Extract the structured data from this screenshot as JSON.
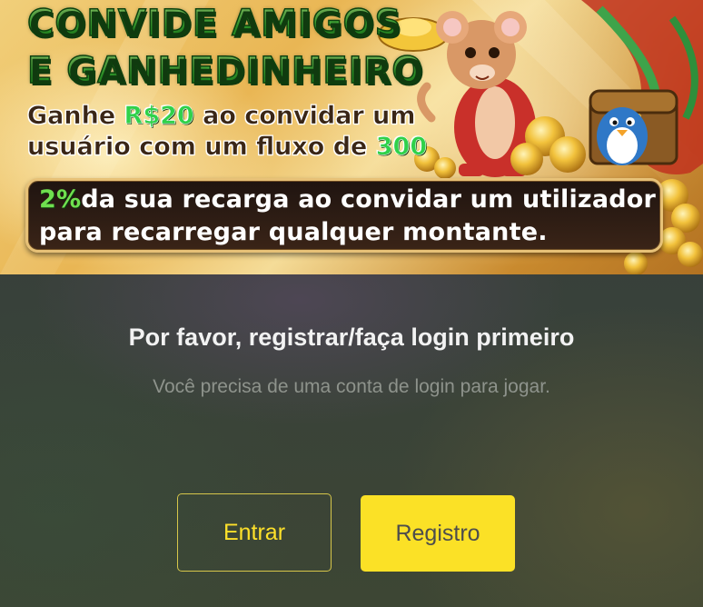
{
  "banner": {
    "headline_line1": "CONVIDE AMIGOS",
    "headline_line2": "E GANHEDINHEIRO",
    "reward_line1_prefix": "Ganhe ",
    "reward_amount": "R$20",
    "reward_line1_suffix": " ao convidar um",
    "reward_line2_prefix": "usuário com um fluxo de ",
    "reward_flow": "300",
    "promo_percent": "2%",
    "promo_line1_rest": "da sua recarga ao convidar um utilizador",
    "promo_line2": "para recarregar qualquer montante."
  },
  "prompt": {
    "title": "Por favor, registrar/faça login primeiro",
    "subtitle": "Você precisa de uma conta de login para jogar."
  },
  "actions": {
    "login_label": "Entrar",
    "register_label": "Registro"
  },
  "colors": {
    "accent_yellow": "#fbe126",
    "headline_green": "#44d63c"
  }
}
